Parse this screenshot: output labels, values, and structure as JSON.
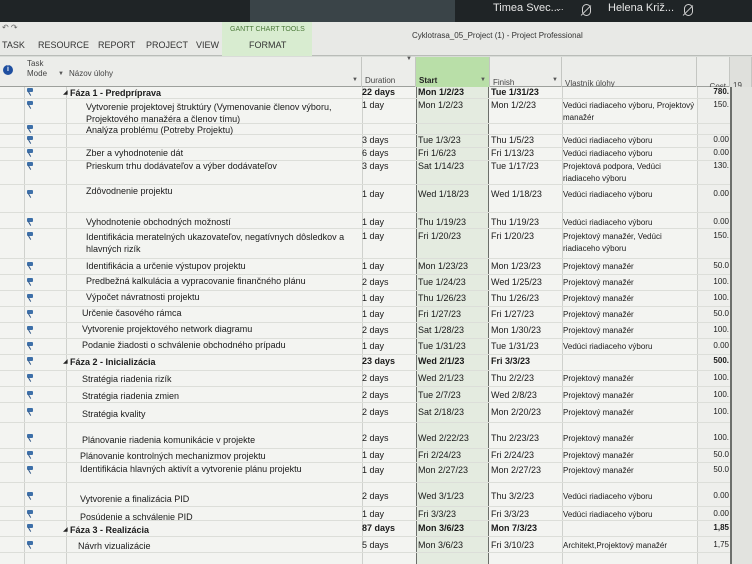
{
  "call": {
    "participants": [
      {
        "name": "Timea Svec..."
      },
      {
        "name": "Helena Križ..."
      }
    ],
    "ellipsis": "..."
  },
  "ribbon": {
    "context_group": "GANTT CHART TOOLS",
    "tabs": [
      "TASK",
      "RESOURCE",
      "REPORT",
      "PROJECT",
      "VIEW",
      "FORMAT"
    ],
    "window_title": "Cyklotrasa_05_Project (1) - Project Professional"
  },
  "columns": {
    "task_mode": "Task\nMode",
    "name": "Názov úlohy",
    "duration": "Duration",
    "start": "Start",
    "finish": "Finish",
    "owner": "Vlastník úlohy",
    "cost": "Cost",
    "gantt_tick": "19"
  },
  "rows": [
    {
      "name": "Fáza 1 - Predpríprava",
      "duration": "22 days",
      "start": "Mon 1/2/23",
      "finish": "Tue 1/31/23",
      "owner": "",
      "cost": "780.",
      "summary": true
    },
    {
      "name": "Vytvorenie projektovej štruktúry (Vymenovanie členov výboru, Projektového manažéra a členov tímu)",
      "duration": "1 day",
      "start": "Mon 1/2/23",
      "finish": "Mon 1/2/23",
      "owner": "Vedúci riadiaceho výboru, Projektový manažér",
      "cost": "150."
    },
    {
      "name": "Analýza problému (Potreby Projektu)",
      "duration": "",
      "start": "",
      "finish": "",
      "owner": "",
      "cost": ""
    },
    {
      "name": "",
      "duration": "3 days",
      "start": "Tue 1/3/23",
      "finish": "Thu 1/5/23",
      "owner": "Vedúci riadiaceho výboru",
      "cost": "0.00"
    },
    {
      "name": "Zber a vyhodnotenie dát",
      "duration": "6 days",
      "start": "Fri 1/6/23",
      "finish": "Fri 1/13/23",
      "owner": "Vedúci riadiaceho výboru",
      "cost": "0.00"
    },
    {
      "name": "Prieskum trhu dodávateľov a výber dodávateľov",
      "duration": "3 days",
      "start": "Sat 1/14/23",
      "finish": "Tue 1/17/23",
      "owner": "Projektová podpora, Vedúci riadiaceho výboru",
      "cost": "130."
    },
    {
      "name": "Zdôvodnenie projektu",
      "duration": "1 day",
      "start": "Wed 1/18/23",
      "finish": "Wed 1/18/23",
      "owner": "Vedúci riadiaceho výboru",
      "cost": "0.00"
    },
    {
      "name": "Vyhodnotenie obchodných možností",
      "duration": "1 day",
      "start": "Thu 1/19/23",
      "finish": "Thu 1/19/23",
      "owner": "Vedúci riadiaceho výboru",
      "cost": "0.00"
    },
    {
      "name": "Identifikácia meratelných ukazovateľov, negatívnych dôsledkov a hlavných rizík",
      "duration": "1 day",
      "start": "Fri 1/20/23",
      "finish": "Fri 1/20/23",
      "owner": "Projektový manažér, Vedúci riadiaceho výboru",
      "cost": "150."
    },
    {
      "name": "Identifikácia a určenie výstupov projektu",
      "duration": "1 day",
      "start": "Mon 1/23/23",
      "finish": "Mon 1/23/23",
      "owner": "Projektový manažér",
      "cost": "50.0"
    },
    {
      "name": "Predbežná kalkulácia a vypracovanie finančného plánu",
      "duration": "2 days",
      "start": "Tue 1/24/23",
      "finish": "Wed 1/25/23",
      "owner": "Projektový manažér",
      "cost": "100."
    },
    {
      "name": "Výpočet návratnosti projektu",
      "duration": "1 day",
      "start": "Thu 1/26/23",
      "finish": "Thu 1/26/23",
      "owner": "Projektový manažér",
      "cost": "100."
    },
    {
      "name": "Určenie časového rámca",
      "duration": "1 day",
      "start": "Fri 1/27/23",
      "finish": "Fri 1/27/23",
      "owner": "Projektový manažér",
      "cost": "50.0"
    },
    {
      "name": "Vytvorenie projektového network diagramu",
      "duration": "2 days",
      "start": "Sat 1/28/23",
      "finish": "Mon 1/30/23",
      "owner": "Projektový manažér",
      "cost": "100."
    },
    {
      "name": "Podanie žiadosti o schválenie obchodného prípadu",
      "duration": "1 day",
      "start": "Tue 1/31/23",
      "finish": "Tue 1/31/23",
      "owner": "Vedúci riadiaceho výboru",
      "cost": "0.00"
    },
    {
      "name": "Fáza 2 - Inicializácia",
      "duration": "23 days",
      "start": "Wed 2/1/23",
      "finish": "Fri 3/3/23",
      "owner": "",
      "cost": "500.",
      "summary": true
    },
    {
      "name": "Stratégia riadenia rizík",
      "duration": "2 days",
      "start": "Wed 2/1/23",
      "finish": "Thu 2/2/23",
      "owner": "Projektový manažér",
      "cost": "100."
    },
    {
      "name": "Stratégia riadenia zmien",
      "duration": "2 days",
      "start": "Tue 2/7/23",
      "finish": "Wed 2/8/23",
      "owner": "Projektový manažér",
      "cost": "100."
    },
    {
      "name": "Stratégia kvality",
      "duration": "2 days",
      "start": "Sat 2/18/23",
      "finish": "Mon 2/20/23",
      "owner": "Projektový manažér",
      "cost": "100."
    },
    {
      "name": "Plánovanie riadenia komunikácie v projekte",
      "duration": "2 days",
      "start": "Wed 2/22/23",
      "finish": "Thu 2/23/23",
      "owner": "Projektový manažér",
      "cost": "100."
    },
    {
      "name": "Plánovanie kontrolných mechanizmov projektu",
      "duration": "1 day",
      "start": "Fri 2/24/23",
      "finish": "Fri 2/24/23",
      "owner": "Projektový manažér",
      "cost": "50.0"
    },
    {
      "name": "Identifikácia hlavných aktivít a vytvorenie plánu projektu",
      "duration": "1 day",
      "start": "Mon 2/27/23",
      "finish": "Mon 2/27/23",
      "owner": "Projektový manažér",
      "cost": "50.0"
    },
    {
      "name": "Vytvorenie a finalizácia PID",
      "duration": "2 days",
      "start": "Wed 3/1/23",
      "finish": "Thu 3/2/23",
      "owner": "Vedúci riadiaceho výboru",
      "cost": "0.00"
    },
    {
      "name": "Posúdenie a schválenie PID",
      "duration": "1 day",
      "start": "Fri 3/3/23",
      "finish": "Fri 3/3/23",
      "owner": "Vedúci riadiaceho výboru",
      "cost": "0.00"
    },
    {
      "name": "Fáza 3 - Realizácia",
      "duration": "87 days",
      "start": "Mon 3/6/23",
      "finish": "Mon 7/3/23",
      "owner": "",
      "cost": "1,85",
      "summary": true
    },
    {
      "name": "Návrh vizualizácie",
      "duration": "5 days",
      "start": "Mon 3/6/23",
      "finish": "Fri 3/10/23",
      "owner": "Architekt,Projektový manažér",
      "cost": "1,75"
    }
  ]
}
